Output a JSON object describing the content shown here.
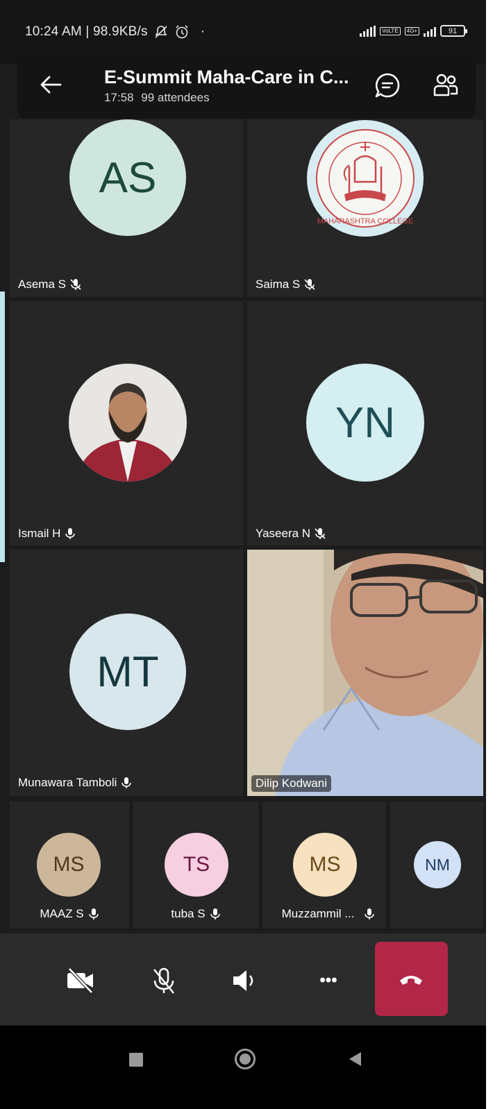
{
  "status_bar": {
    "left_text": "10:24 AM | 98.9KB/s",
    "dot": "·",
    "network_badge": "4G+",
    "volte_badge": "VoLTE",
    "battery": "91"
  },
  "header": {
    "title": "E-Summit Maha-Care in C...",
    "duration": "17:58",
    "attendees": "99 attendees"
  },
  "participants": [
    {
      "initials": "AS",
      "name": "Asema S",
      "mic": "muted",
      "avatar_bg": "#cfe6de",
      "initials_color": "#1e4a3e"
    },
    {
      "name": "Saima S",
      "mic": "muted",
      "avatar_type": "college-logo",
      "logo_text": "MAHARASHTRA COLLEGE",
      "logo_color": "#c9484b"
    },
    {
      "name": "Ismail H",
      "mic": "on",
      "avatar_type": "photo"
    },
    {
      "initials": "YN",
      "name": "Yaseera N",
      "mic": "muted",
      "avatar_bg": "#d4eef1",
      "initials_color": "#1f4f56"
    },
    {
      "initials": "MT",
      "name": "Munawara Tamboli",
      "mic": "on",
      "avatar_bg": "#d8e7ec",
      "initials_color": "#15383f"
    },
    {
      "name": "Dilip Kodwani",
      "mic": "video",
      "avatar_type": "video"
    }
  ],
  "strip": [
    {
      "initials": "MS",
      "name": "MAAZ S",
      "mic": "on",
      "avatar_bg": "#cdb79a",
      "initials_color": "#4f3a1c"
    },
    {
      "initials": "TS",
      "name": "tuba S",
      "mic": "on",
      "avatar_bg": "#f6cfe0",
      "initials_color": "#6a1740"
    },
    {
      "initials": "MS",
      "name": "Muzzammil ...",
      "mic": "on",
      "avatar_bg": "#f7e1c0",
      "initials_color": "#6b4a18"
    },
    {
      "initials": "NM",
      "name": "",
      "mic": "",
      "avatar_bg": "#d2e1f5",
      "initials_color": "#1d3a66"
    }
  ],
  "controls": {
    "camera": "camera-off",
    "mic": "mic-off",
    "speaker": "speaker-on",
    "more": "•••",
    "end_call_color": "#b22647"
  }
}
